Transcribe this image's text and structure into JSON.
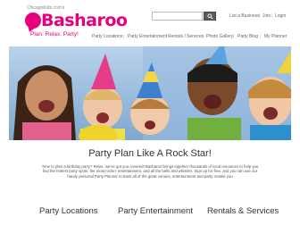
{
  "logo": {
    "small": "ChicagoKids.com's",
    "name": "Basharoo",
    "tagline": "Plan. Relax. Party!"
  },
  "search": {
    "placeholder": "",
    "button_icon": "search-icon"
  },
  "toplinks": [
    "List a Business",
    "Join",
    "Login"
  ],
  "nav": [
    "Party Locations",
    "Party Entertainment",
    "Rentals / Services",
    "Photo Gallery",
    "Party Blog",
    "My Planner"
  ],
  "main": {
    "tagline": "Party Plan Like A Rock Star!",
    "body": "Time to plan a birthday party? Relax, we've got you covered! Basharoo brings together thousands of local resources to help you find the hottest party spots, the most rockin' entertainment, and all the bells and whistles. Sign up for free, and you can use our handy personal Party Planner to track all of the great venues, entertainment and party rentals you"
  },
  "categories": [
    "Party Locations",
    "Party Entertainment",
    "Rentals & Services"
  ],
  "colors": {
    "brand": "#e6007e",
    "search_button": "#5b5b5b"
  }
}
